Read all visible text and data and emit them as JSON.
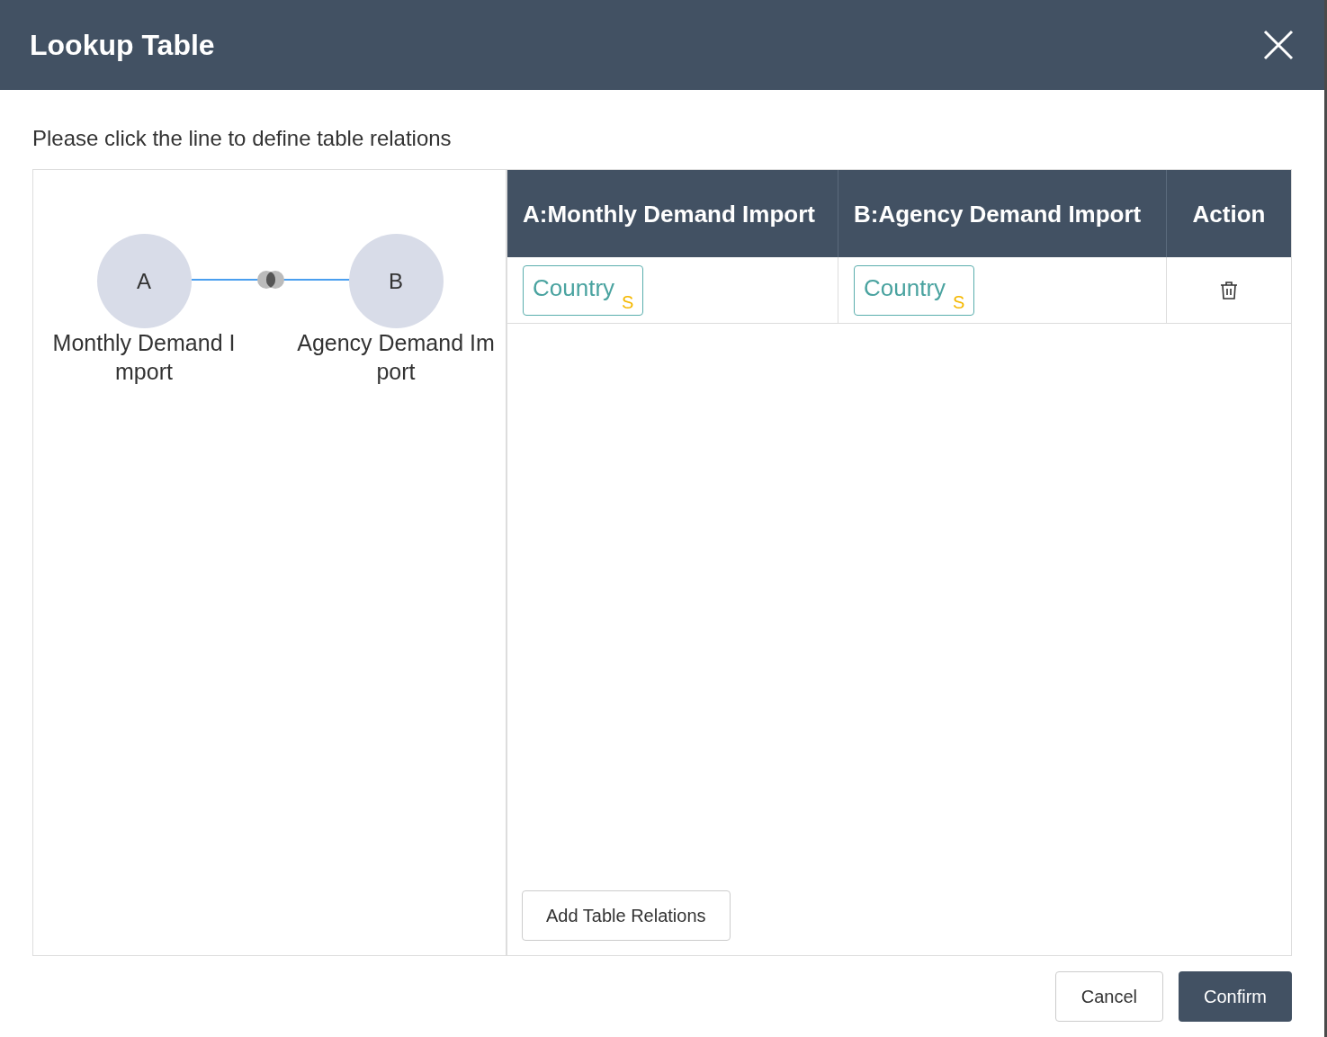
{
  "dialog": {
    "title": "Lookup Table"
  },
  "instruction": "Please click the line to define table relations",
  "diagram": {
    "nodes": [
      {
        "letter": "A",
        "name": "Monthly Demand Import"
      },
      {
        "letter": "B",
        "name": "Agency Demand Import"
      }
    ]
  },
  "table": {
    "columns": [
      "A:Monthly Demand Import",
      "B:Agency Demand Import",
      "Action"
    ],
    "rows": [
      {
        "a": {
          "field": "Country",
          "type": "S"
        },
        "b": {
          "field": "Country",
          "type": "S"
        }
      }
    ]
  },
  "add_button": "Add Table Relations",
  "buttons": [
    {
      "label": "Cancel",
      "kind": "secondary"
    },
    {
      "label": "Confirm",
      "kind": "primary"
    }
  ]
}
